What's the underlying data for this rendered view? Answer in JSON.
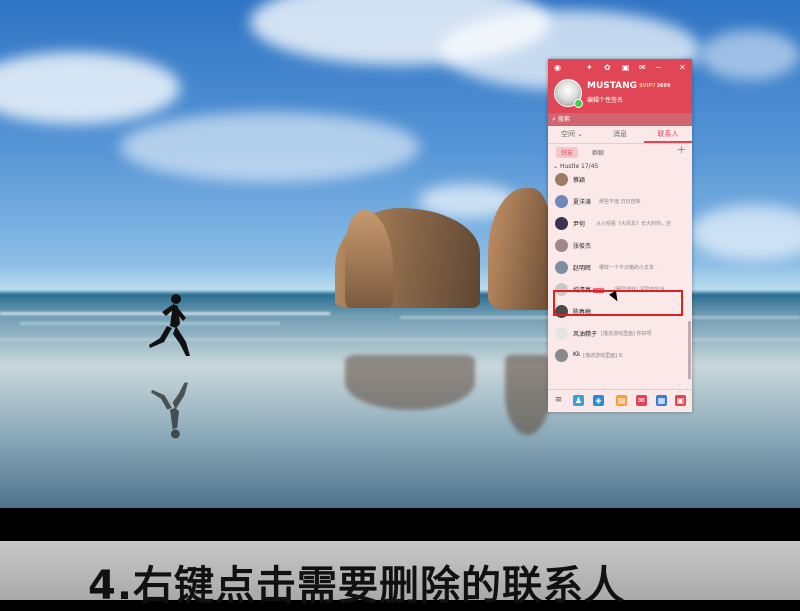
{
  "profile": {
    "username": "MUSTANG",
    "vip_badge": "SVIP7",
    "level_badge": "3899",
    "signature": "编辑个性签名"
  },
  "search": {
    "placeholder": "搜索"
  },
  "tabs": [
    {
      "label": "空间",
      "active": false
    },
    {
      "label": "消息",
      "active": false
    },
    {
      "label": "联系人",
      "active": true
    }
  ],
  "subtabs": {
    "friends": "好友",
    "groups": "群聊"
  },
  "group": {
    "name": "Hustle",
    "count": "17/45"
  },
  "contacts": [
    {
      "name": "蔡颖",
      "status": ""
    },
    {
      "name": "夏洋涛",
      "status": "那些不值 日日自新"
    },
    {
      "name": "尹何",
      "status": "从小观看《大风车》长大的你，还"
    },
    {
      "name": "张俊杰",
      "status": ""
    },
    {
      "name": "赵明晖",
      "status": "哪样一个不识格的小文本 ."
    },
    {
      "name": "炖清亮",
      "badge": "SVIP",
      "status": "[圈层游戏]  深层知的道"
    },
    {
      "name": "陈春梅",
      "status": ""
    },
    {
      "name": "风油精子",
      "status": "[描述游戏里面]  你好呀"
    },
    {
      "name": "Kk",
      "status": "[描述游戏里面]  lll"
    }
  ],
  "caption": {
    "text": "4.右键点击需要删除的联系人"
  },
  "colors": {
    "accent": "#e14656",
    "highlight": "#e02020",
    "panel_bg": "#fbe9ea"
  }
}
